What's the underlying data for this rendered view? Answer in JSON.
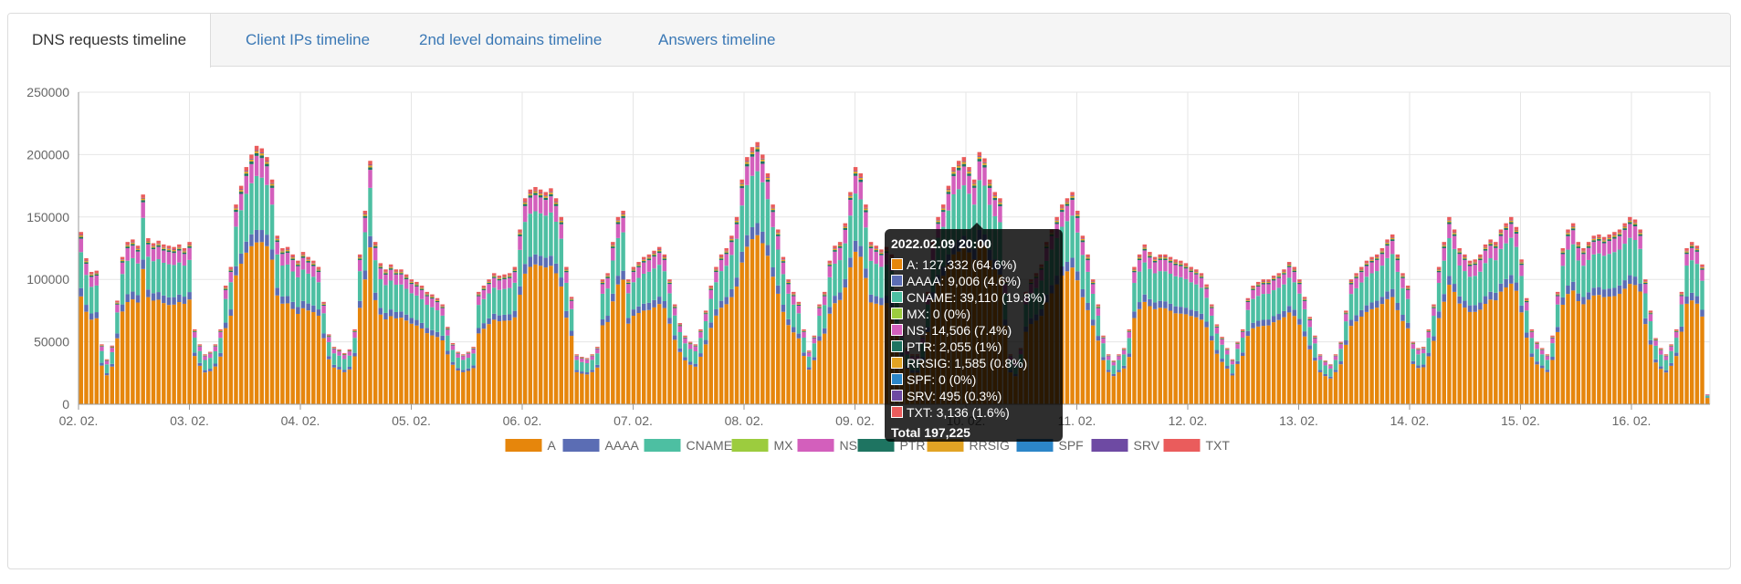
{
  "tabs": [
    {
      "label": "DNS requests timeline",
      "active": true
    },
    {
      "label": "Client IPs timeline",
      "active": false
    },
    {
      "label": "2nd level domains timeline",
      "active": false
    },
    {
      "label": "Answers timeline",
      "active": false
    }
  ],
  "chart_data": {
    "type": "bar",
    "stacked": true,
    "grid": true,
    "legend_position": "bottom",
    "ylim": [
      0,
      250000
    ],
    "y_ticks": [
      "0",
      "50000",
      "100000",
      "150000",
      "200000",
      "250000"
    ],
    "x_ticks": [
      "02. 02.",
      "03. 02.",
      "04. 02.",
      "05. 02.",
      "06. 02.",
      "07. 02.",
      "08. 02.",
      "09. 02.",
      "10. 02.",
      "11. 02.",
      "12. 02.",
      "13. 02.",
      "14. 02.",
      "15. 02.",
      "16. 02."
    ],
    "bars_per_day": 24,
    "daily_totals": [
      138000,
      117000,
      106000,
      107000,
      48000,
      36000,
      47000,
      83000,
      118000,
      130000,
      132000,
      127000,
      168000,
      133000,
      129000,
      131000,
      128000,
      127000,
      126000,
      128000,
      125000,
      130000,
      60000,
      48000,
      40000,
      42000,
      48000,
      60000,
      95000,
      110000,
      160000,
      175000,
      190000,
      200000,
      207000,
      205000,
      198000,
      180000,
      135000,
      125000,
      126000,
      120000,
      115000,
      122000,
      118000,
      115000,
      110000,
      82000,
      56000,
      46000,
      44000,
      41000,
      44000,
      60000,
      120000,
      155000,
      195000,
      130000,
      113000,
      108000,
      112000,
      108000,
      108000,
      104000,
      100000,
      98000,
      95000,
      90000,
      88000,
      85000,
      80000,
      62000,
      49000,
      42000,
      40000,
      42000,
      46000,
      90000,
      95000,
      100000,
      105000,
      103000,
      104000,
      105000,
      110000,
      140000,
      165000,
      172000,
      174000,
      172000,
      170000,
      173000,
      165000,
      150000,
      110000,
      86000,
      40000,
      38000,
      37000,
      40000,
      46000,
      100000,
      105000,
      130000,
      150000,
      155000,
      100000,
      110000,
      114000,
      118000,
      120000,
      123000,
      126000,
      120000,
      100000,
      80000,
      65000,
      55000,
      50000,
      48000,
      60000,
      75000,
      95000,
      110000,
      120000,
      125000,
      135000,
      150000,
      180000,
      198000,
      206000,
      210000,
      200000,
      185000,
      160000,
      140000,
      118000,
      100000,
      90000,
      82000,
      60000,
      43000,
      55000,
      80000,
      90000,
      115000,
      127000,
      130000,
      145000,
      170000,
      190000,
      185000,
      160000,
      130000,
      127000,
      124000,
      126000,
      120000,
      92000,
      60000,
      45000,
      40000,
      40000,
      55000,
      90000,
      130000,
      150000,
      160000,
      175000,
      190000,
      195000,
      198000,
      190000,
      180000,
      202000,
      197000,
      180000,
      170000,
      165000,
      100000,
      40000,
      35000,
      45000,
      90000,
      100000,
      105000,
      112000,
      130000,
      140000,
      150000,
      160000,
      165000,
      170000,
      155000,
      135000,
      120000,
      100000,
      80000,
      55000,
      40000,
      35000,
      40000,
      45000,
      60000,
      110000,
      120000,
      128000,
      122000,
      118000,
      120000,
      120000,
      118000,
      116000,
      115000,
      113000,
      110000,
      108000,
      105000,
      96000,
      80000,
      64000,
      54000,
      45000,
      36000,
      50000,
      60000,
      85000,
      95000,
      98000,
      100000,
      100000,
      103000,
      105000,
      108000,
      114000,
      110000,
      100000,
      86000,
      70000,
      55000,
      40000,
      35000,
      32000,
      40000,
      50000,
      75000,
      100000,
      105000,
      110000,
      115000,
      118000,
      120000,
      125000,
      132000,
      136000,
      120000,
      105000,
      95000,
      50000,
      45000,
      46000,
      60000,
      80000,
      110000,
      130000,
      150000,
      140000,
      125000,
      120000,
      115000,
      116000,
      120000,
      128000,
      132000,
      130000,
      140000,
      145000,
      150000,
      142000,
      116000,
      85000,
      60000,
      50000,
      45000,
      40000,
      55000,
      90000,
      125000,
      140000,
      145000,
      130000,
      125000,
      130000,
      135000,
      136000,
      134000,
      136000,
      138000,
      140000,
      145000,
      150000,
      148000,
      140000,
      100000,
      75000,
      53000,
      45000,
      40000,
      48000,
      60000,
      90000,
      125000,
      130000,
      127000,
      112000,
      8000
    ],
    "series": [
      {
        "name": "A",
        "color": "#e6860c"
      },
      {
        "name": "AAAA",
        "color": "#5b6db4"
      },
      {
        "name": "CNAME",
        "color": "#4dbfa2"
      },
      {
        "name": "MX",
        "color": "#9ccc3e"
      },
      {
        "name": "NS",
        "color": "#d35fbc"
      },
      {
        "name": "PTR",
        "color": "#1e7461"
      },
      {
        "name": "RRSIG",
        "color": "#e2a324"
      },
      {
        "name": "SPF",
        "color": "#2c86c8"
      },
      {
        "name": "SRV",
        "color": "#6e4aa3"
      },
      {
        "name": "TXT",
        "color": "#ea5c5c"
      }
    ],
    "series_shares": [
      0.646,
      0.046,
      0.198,
      0.0,
      0.074,
      0.01,
      0.008,
      0.0,
      0.003,
      0.016
    ],
    "tooltip": {
      "title": "2022.02.09 20:00",
      "rows": [
        "A: 127,332 (64.6%)",
        "AAAA: 9,006 (4.6%)",
        "CNAME: 39,110 (19.8%)",
        "MX: 0 (0%)",
        "NS: 14,506 (7.4%)",
        "PTR: 2,055 (1%)",
        "RRSIG: 1,585 (0.8%)",
        "SPF: 0 (0%)",
        "SRV: 495 (0.3%)",
        "TXT: 3,136 (1.6%)"
      ],
      "total": "Total 197,225"
    }
  }
}
